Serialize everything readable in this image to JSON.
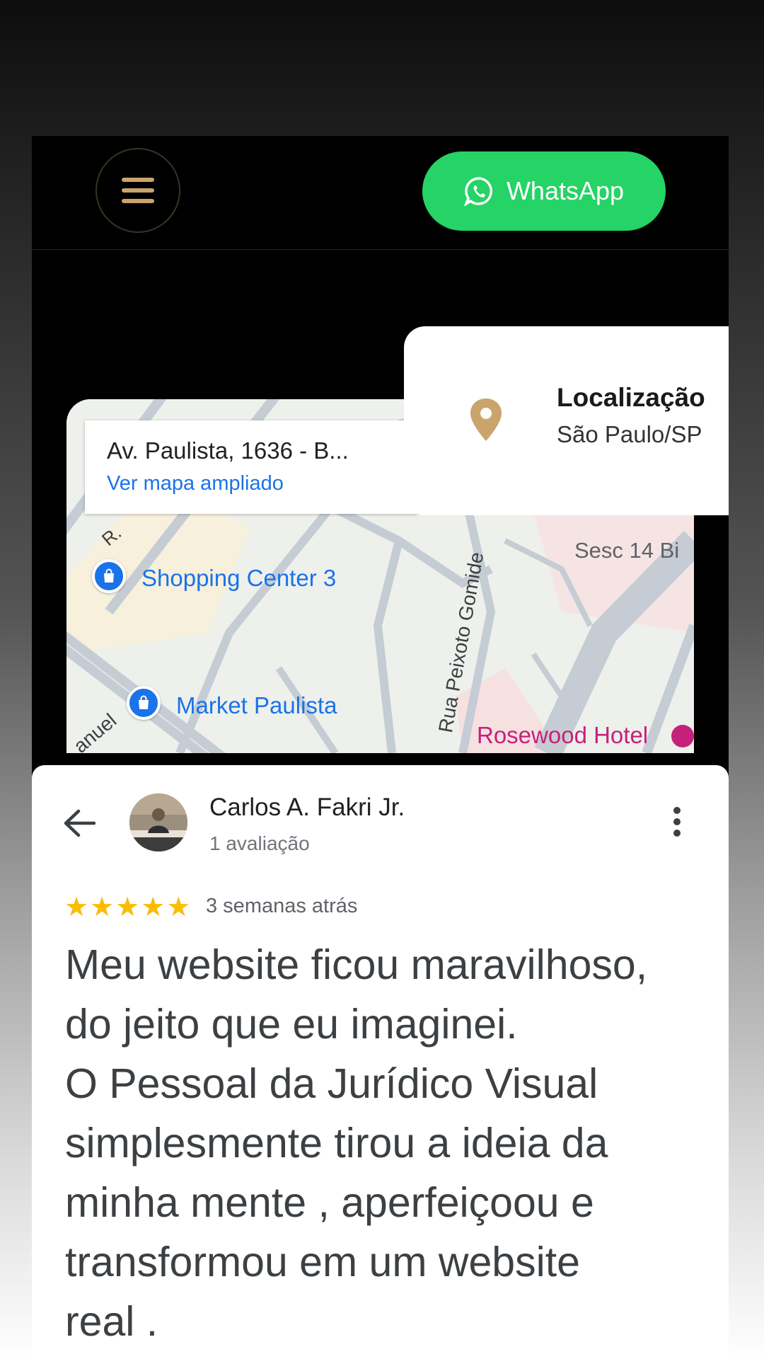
{
  "header": {
    "menu_icon": "hamburger-icon",
    "whatsapp_label": "WhatsApp",
    "whatsapp_icon": "whatsapp-icon",
    "whatsapp_color": "#25d366",
    "accent_color": "#c9a46c"
  },
  "map": {
    "address": "Av. Paulista, 1636 - B...",
    "view_larger_link": "Ver mapa ampliado",
    "places": [
      {
        "label": "Shopping Center 3",
        "icon": "shopping-bag-icon"
      },
      {
        "label": "Market Paulista",
        "icon": "shopping-bag-icon"
      },
      {
        "label": "Sesc 14 Bi"
      },
      {
        "label": "Rosewood Hotel",
        "icon": "hotel-icon"
      }
    ],
    "streets": [
      "Rua Peixoto Gomide",
      "R.",
      "anuel"
    ]
  },
  "location_card": {
    "title": "Localização",
    "subtitle": "São Paulo/SP",
    "icon": "map-pin-icon"
  },
  "review": {
    "reviewer_name": "Carlos A. Fakri Jr.",
    "review_count": "1 avaliação",
    "rating": 5,
    "time_ago": "3 semanas atrás",
    "text": "Meu website ficou maravilhoso,\ndo jeito que eu imaginei.\nO Pessoal da Jurídico Visual\nsimplesmente tirou a ideia da\nminha mente , aperfeiçoou e\ntransformou em um website\nreal ."
  }
}
